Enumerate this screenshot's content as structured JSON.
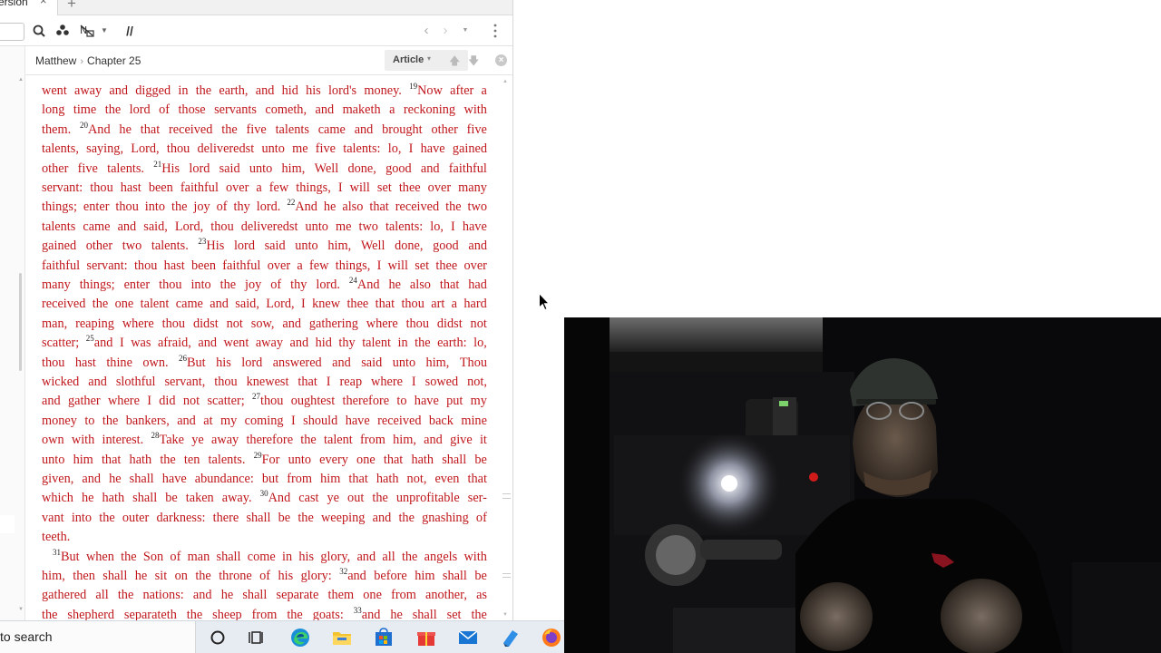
{
  "tab": {
    "label": "ersion",
    "close_glyph": "×",
    "add_glyph": "+"
  },
  "toolbar": {
    "icons": [
      "search-icon",
      "people-icon",
      "filter-icon",
      "chevron-down-icon",
      "parallel-icon",
      "back-arrow-icon",
      "forward-arrow-icon",
      "history-dropdown-icon",
      "more-icon"
    ],
    "parallel_label": "//"
  },
  "breadcrumb": {
    "book": "Matthew",
    "separator": "›",
    "chapter": "Chapter 25"
  },
  "view": {
    "mode_label": "Article",
    "caret": "▾",
    "up_arrow": "🡅",
    "down_arrow": "🡇",
    "close_glyph": "×"
  },
  "passage": {
    "color": "#c0171c",
    "lines": [
      [
        {
          "t": "went away and digged in the earth, and hid his lord's money."
        },
        {
          "v": "19"
        },
        {
          "t": "Now after a"
        }
      ],
      [
        {
          "t": "long time the lord of those servants cometh, and maketh a reckoning with"
        }
      ],
      [
        {
          "t": "them."
        },
        {
          "v": "20"
        },
        {
          "t": "And he that received the five talents came and brought other five"
        }
      ],
      [
        {
          "t": "talents, saying, Lord, thou deliveredst unto me five talents: lo, I have gained"
        }
      ],
      [
        {
          "t": "other five talents."
        },
        {
          "v": "21"
        },
        {
          "t": "His lord said unto him, Well done, good and faithful"
        }
      ],
      [
        {
          "t": "servant: thou hast been faithful over a few things, I will set thee over many"
        }
      ],
      [
        {
          "t": "things; enter thou into the joy of thy lord."
        },
        {
          "v": "22"
        },
        {
          "t": "And he also that received the two"
        }
      ],
      [
        {
          "t": "talents came and said, Lord, thou deliveredst unto me two talents: lo, I have"
        }
      ],
      [
        {
          "t": "gained other two talents."
        },
        {
          "v": "23"
        },
        {
          "t": "His lord said unto him, Well done, good and"
        }
      ],
      [
        {
          "t": "faithful servant: thou hast been faithful over a few things, I will set thee over"
        }
      ],
      [
        {
          "t": "many things; enter thou into the joy of thy lord."
        },
        {
          "v": "24"
        },
        {
          "t": "And he also that had"
        }
      ],
      [
        {
          "t": "received the one talent came and said, Lord, I knew thee that thou art a hard"
        }
      ],
      [
        {
          "t": "man, reaping where thou didst not sow, and gathering where thou didst not"
        }
      ],
      [
        {
          "t": "scatter;"
        },
        {
          "v": "25"
        },
        {
          "t": "and I was afraid, and went away and hid thy talent in the earth: lo,"
        }
      ],
      [
        {
          "t": "thou hast thine own."
        },
        {
          "v": "26"
        },
        {
          "t": "But his lord answered and said unto him, Thou"
        }
      ],
      [
        {
          "t": "wicked and slothful servant, thou knewest that I reap where I sowed not,"
        }
      ],
      [
        {
          "t": "and gather where I did not scatter;"
        },
        {
          "v": "27"
        },
        {
          "t": "thou oughtest therefore to have put my"
        }
      ],
      [
        {
          "t": "money to the bankers, and at my coming I should have received back mine"
        }
      ],
      [
        {
          "t": "own with interest."
        },
        {
          "v": "28"
        },
        {
          "t": "Take ye away therefore the talent from him, and give it"
        }
      ],
      [
        {
          "t": "unto him that hath the ten talents."
        },
        {
          "v": "29"
        },
        {
          "t": "For unto every one that hath shall be"
        }
      ],
      [
        {
          "t": "given, and he shall have abundance: but from him that hath not, even that"
        }
      ],
      [
        {
          "t": "which he hath shall be taken away."
        },
        {
          "v": "30"
        },
        {
          "t": "And cast ye out the unprofitable ser-"
        }
      ],
      [
        {
          "t": "vant into the outer darkness: there shall be the weeping and the gnashing of"
        }
      ],
      [
        {
          "t": "teeth."
        }
      ],
      [
        {
          "v": "31"
        },
        {
          "t": "But when the Son of man shall come in his glory, and all the angels with"
        }
      ],
      [
        {
          "t": "him, then shall he sit on the throne of his glory:"
        },
        {
          "v": "32"
        },
        {
          "t": "and before him shall be"
        }
      ],
      [
        {
          "t": "gathered all the nations: and he shall separate them one from another, as"
        }
      ],
      [
        {
          "t": "the shepherd separateth the sheep from the goats:"
        },
        {
          "v": "33"
        },
        {
          "t": "and he shall set the"
        }
      ]
    ]
  },
  "taskbar": {
    "search_text": "to search",
    "apps": [
      "cortana-icon",
      "task-view-icon",
      "edge-icon",
      "file-explorer-icon",
      "store-icon",
      "gift-icon",
      "mail-icon",
      "app-icon",
      "firefox-icon"
    ]
  }
}
